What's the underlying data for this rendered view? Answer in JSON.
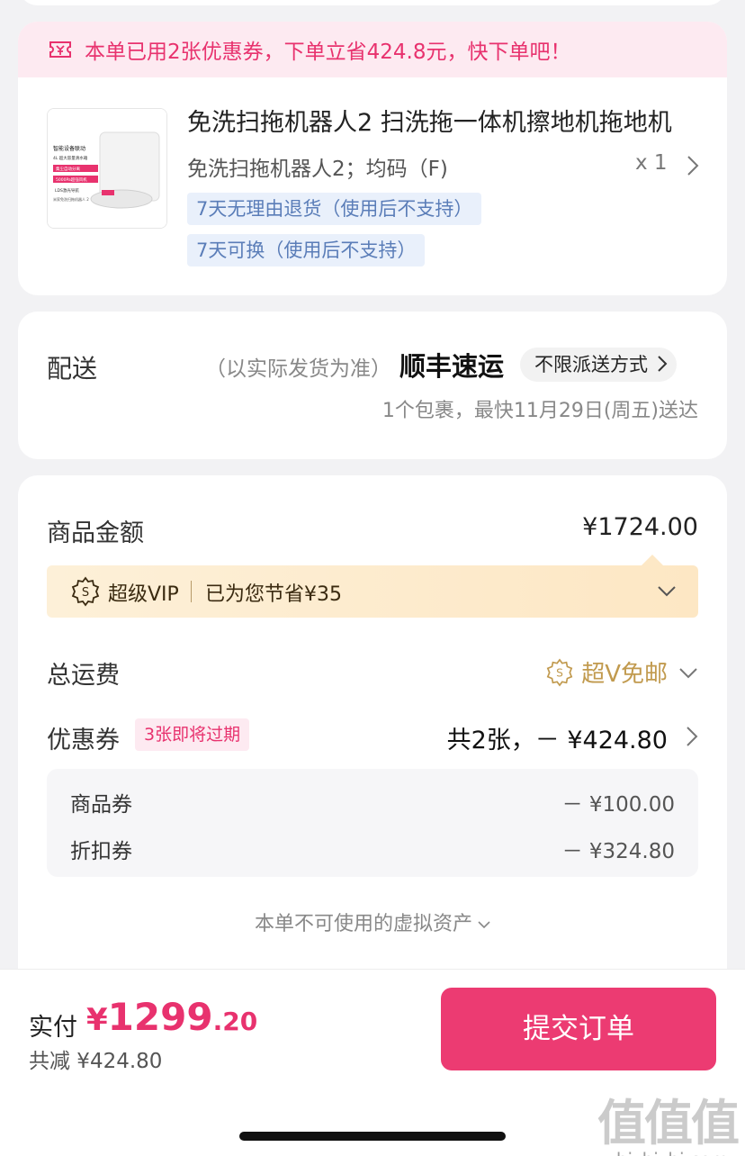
{
  "coupon_banner": {
    "text": "本单已用2张优惠券，下单立省424.8元，快下单吧！"
  },
  "product": {
    "title": "免洗扫拖机器人2 扫洗拖一体机擦地机拖地机",
    "spec": "免洗扫拖机器人2；均码（F)",
    "quantity": "x 1",
    "tags": [
      "7天无理由退货（使用后不支持）",
      "7天可换（使用后不支持）"
    ],
    "thumb_lines": [
      "智能设备联动",
      "4L 超大容量清水箱",
      "集尘自动分离",
      "5000Pa超强风机",
      "LDS激光导航",
      "米家免洗扫拖机器人 2"
    ]
  },
  "delivery": {
    "label": "配送",
    "note": "（以实际发货为准）",
    "carrier": "顺丰速运",
    "method": "不限派送方式",
    "eta": "1个包裹，最快11月29日(周五)送达"
  },
  "price": {
    "goods_label": "商品金额",
    "goods_value": "¥1724.00",
    "vip_title": "超级VIP",
    "vip_saved": "已为您节省¥35",
    "shipping_label": "总运费",
    "shipping_value": "超V免邮",
    "coupon_label": "优惠券",
    "coupon_badge": "3张即将过期",
    "coupon_total": "共2张，－ ¥424.80",
    "coupon_items": [
      {
        "label": "商品券",
        "value": "－ ¥100.00"
      },
      {
        "label": "折扣券",
        "value": "－ ¥324.80"
      }
    ],
    "virtual_assets": "本单不可使用的虚拟资产"
  },
  "footer": {
    "pay_label": "实付",
    "pay_currency": "¥",
    "pay_int": "1299",
    "pay_dec": ".20",
    "saved": "共减 ¥424.80",
    "submit": "提交订单"
  },
  "watermark": {
    "logo": "值值值",
    "url": "zhizhizhi.com"
  },
  "colors": {
    "accent": "#ec3b72",
    "banner_bg": "#fdeaf1",
    "vip_gold": "#c19a4e",
    "tag_blue": "#5a7db8"
  },
  "icons": [
    "coupon-ticket-icon",
    "chevron-right-icon",
    "vip-badge-icon",
    "chevron-down-icon"
  ]
}
